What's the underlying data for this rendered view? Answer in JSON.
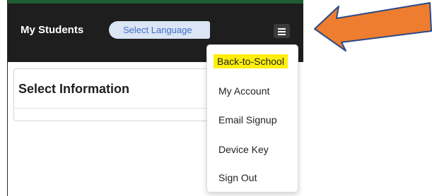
{
  "header": {
    "title": "My Students",
    "language_select": "Select Language",
    "menu_icon": "hamburger-icon"
  },
  "card": {
    "title": "Select Information"
  },
  "menu": {
    "items": [
      "Back-to-School",
      "My Account",
      "Email Signup",
      "Device Key",
      "Sign Out"
    ],
    "highlight_color": "#ffef0a"
  },
  "annotation": {
    "arrow_color": "#ee7d2f",
    "arrow_outline": "#2b4a86"
  },
  "colors": {
    "topbar": "#1e1e1e",
    "accent_strip": "#1f5d33",
    "language_text": "#3f6fc6"
  }
}
